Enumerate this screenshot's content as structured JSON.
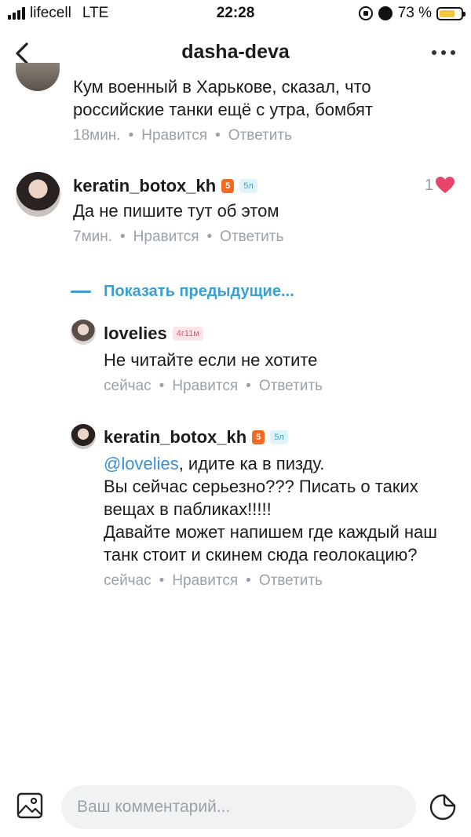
{
  "status_bar": {
    "carrier": "lifecell",
    "network": "LTE",
    "time": "22:28",
    "battery_text": "73 %",
    "battery_level": 0.73
  },
  "header": {
    "title": "dasha-deva"
  },
  "comments": [
    {
      "text": "Кум военный в Харькове,  сказал,  что российские танки ещё с утра, бомбят",
      "time": "18мин.",
      "like_label": "Нравится",
      "reply_label": "Ответить"
    },
    {
      "username": "keratin_botox_kh",
      "level_badge": "5",
      "years_badge": "5л",
      "text": "Да не пишите тут об этом",
      "time": "7мин.",
      "like_label": "Нравится",
      "reply_label": "Ответить",
      "likes": "1"
    }
  ],
  "show_previous_label": "Показать предыдущие...",
  "replies": [
    {
      "username": "lovelies",
      "age_badge": "4г11м",
      "text": "Не читайте если не хотите",
      "time": "сейчас",
      "like_label": "Нравится",
      "reply_label": "Ответить"
    },
    {
      "username": "keratin_botox_kh",
      "level_badge": "5",
      "years_badge": "5л",
      "mention": "@lovelies",
      "text_after_mention": ", идите ка в пизду.",
      "text_line2": "Вы сейчас серьезно??? Писать о таких вещах в пабликах!!!!!",
      "text_line3": "Давайте может напишем где каждый наш танк стоит и скинем сюда геолокацию?",
      "time": "сейчас",
      "like_label": "Нравится",
      "reply_label": "Ответить"
    }
  ],
  "composer": {
    "placeholder": "Ваш комментарий..."
  },
  "colors": {
    "accent": "#3aa0d0",
    "heart": "#e8456a",
    "level_badge": "#f26a22",
    "meta_text": "#9aa1a8"
  }
}
